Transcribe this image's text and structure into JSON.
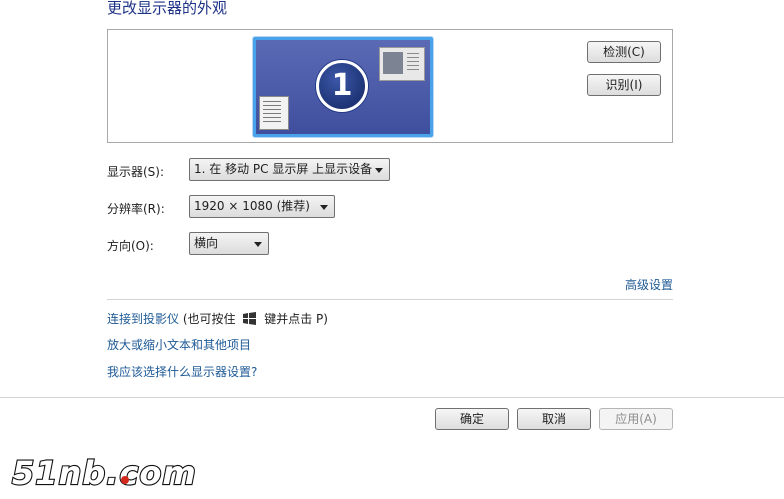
{
  "page": {
    "title": "更改显示器的外观"
  },
  "preview": {
    "monitor_number": "1"
  },
  "buttons": {
    "detect": "检测(C)",
    "identify": "识别(I)"
  },
  "fields": {
    "display": {
      "label": "显示器(S):",
      "value": "1. 在 移动 PC 显示屏 上显示设备"
    },
    "resolution": {
      "label": "分辨率(R):",
      "value": "1920 × 1080 (推荐)"
    },
    "orientation": {
      "label": "方向(O):",
      "value": "横向"
    }
  },
  "advanced_link": "高级设置",
  "links": {
    "projector": "连接到投影仪",
    "projector_hint_prefix": "(也可按住",
    "projector_hint_suffix": "键并点击 P)",
    "zoom": "放大或缩小文本和其他项目",
    "which_settings": "我应该选择什么显示器设置?"
  },
  "footer": {
    "ok": "确定",
    "cancel": "取消",
    "apply": "应用(A)"
  },
  "watermark": "51nb.com"
}
